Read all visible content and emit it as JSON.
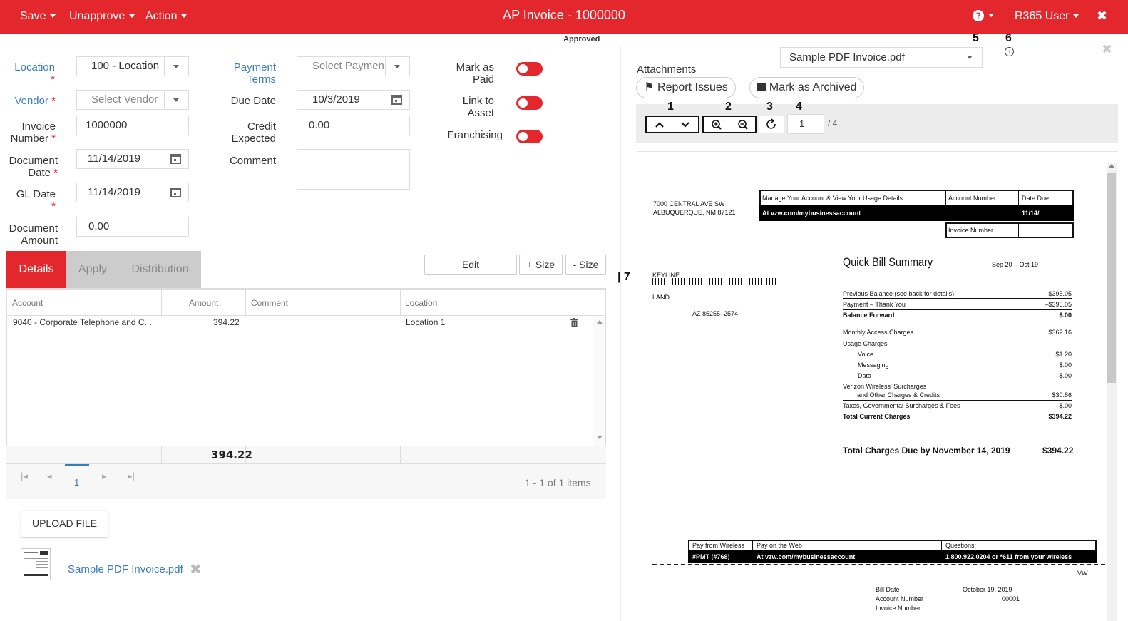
{
  "topbar": {
    "save": "Save",
    "unapprove": "Unapprove",
    "action": "Action",
    "title": "AP Invoice - 1000000",
    "help_icon": "?",
    "user": "R365 User",
    "close": "✖",
    "bg_color": "#e3272d"
  },
  "status": "Approved",
  "form": {
    "location_label": "Location",
    "location_value": "100 - Location",
    "vendor_label": "Vendor",
    "vendor_placeholder": "Select Vendor",
    "invoice_number_label_1": "Invoice",
    "invoice_number_label_2": "Number",
    "invoice_number_value": "1000000",
    "document_date_label_1": "Document",
    "document_date_label_2": "Date",
    "document_date_value": "11/14/2019",
    "gl_date_label": "GL Date",
    "gl_date_value": "11/14/2019",
    "document_amount_label_1": "Document",
    "document_amount_label_2": "Amount",
    "document_amount_value": "0.00",
    "payment_terms_label_1": "Payment",
    "payment_terms_label_2": "Terms",
    "payment_terms_placeholder": "Select Paymen",
    "due_date_label": "Due Date",
    "due_date_value": "10/3/2019",
    "credit_expected_label_1": "Credit",
    "credit_expected_label_2": "Expected",
    "credit_expected_value": "0.00",
    "comment_label": "Comment",
    "mark_as_paid_label_1": "Mark as",
    "mark_as_paid_label_2": "Paid",
    "link_to_asset_label_1": "Link to",
    "link_to_asset_label_2": "Asset",
    "franchising_label": "Franchising",
    "required_mark": "*"
  },
  "tabs": [
    "Details",
    "Apply",
    "Distribution"
  ],
  "grid_buttons": {
    "edit": "Edit",
    "plus_size": "+ Size",
    "minus_size": "- Size"
  },
  "grid": {
    "columns": [
      "Account",
      "Amount",
      "Comment",
      "Location"
    ],
    "rows": [
      {
        "account": "9040 - Corporate Telephone and C...",
        "amount": "394.22",
        "comment": "",
        "location": "Location 1"
      }
    ],
    "total": "394.22",
    "page": "1",
    "items_text": "1 - 1 of 1 items"
  },
  "upload": {
    "button": "UPLOAD FILE",
    "file_name": "Sample PDF Invoice.pdf"
  },
  "viewer": {
    "file_select": "Sample PDF Invoice.pdf",
    "attachments_label": "Attachments",
    "report_issues": "Report Issues",
    "mark_archived": "Mark as Archived",
    "markers": [
      "1",
      "2",
      "3",
      "4",
      "5",
      "6",
      "7"
    ],
    "page_input": "1",
    "page_total": "/ 4"
  },
  "invoice_doc": {
    "address_1": "7000 CENTRAL AVE SW",
    "address_2": "ALBUQUERQUE, NM 87121",
    "manage_text": "Manage Your Account & View Your Usage Details",
    "account_number_h": "Account Number",
    "date_due_h": "Date Due",
    "url": "At vzw.com/mybusinessaccount",
    "date_due_v": "11/14/",
    "invoice_number_h": "Invoice Number",
    "keyline": "KEYLINE",
    "land": "LAND",
    "az": "AZ  85255–2574",
    "summary_title": "Quick Bill Summary",
    "period": "Sep 20 – Oct 19",
    "lines": [
      {
        "label": "Previous Balance  (see back for details)",
        "value": "$395.05",
        "bold": false
      },
      {
        "label": "Payment – Thank You",
        "value": "–$395.05",
        "bold": false
      },
      {
        "label": "Balance Forward",
        "value": "$.00",
        "bold": true
      },
      {
        "label": "Monthly Access Charges",
        "value": "$362.16",
        "bold": false
      },
      {
        "label": "Usage Charges",
        "value": "",
        "bold": false
      },
      {
        "label": "Voice",
        "value": "$1.20",
        "bold": false
      },
      {
        "label": "Messaging",
        "value": "$.00",
        "bold": false
      },
      {
        "label": "Data",
        "value": "$.00",
        "bold": false
      },
      {
        "label": "Verizon Wireless' Surcharges",
        "value": "",
        "bold": false
      },
      {
        "label": "and Other Charges & Credits",
        "value": "$30.86",
        "bold": false
      },
      {
        "label": "Taxes, Governmental Surcharges & Fees",
        "value": "$.00",
        "bold": false
      },
      {
        "label": "Total Current Charges",
        "value": "$394.22",
        "bold": true
      }
    ],
    "total_due_label": "Total Charges Due by November 14, 2019",
    "total_due_value": "$394.22",
    "pay_wireless": "Pay from Wireless",
    "pay_web": "Pay on the Web",
    "questions": "Questions:",
    "pmt": "#PMT (#768)",
    "pay_url": "At vzw.com/mybusinessaccount",
    "phone": "1.800.922.0204 or *611 from your wireless",
    "vw": "VW",
    "bill_date_l": "Bill Date",
    "bill_date_v": "October 19, 2019",
    "account_number_l": "Account Number",
    "account_number_v": "00001",
    "invoice_number_l": "Invoice Number"
  }
}
